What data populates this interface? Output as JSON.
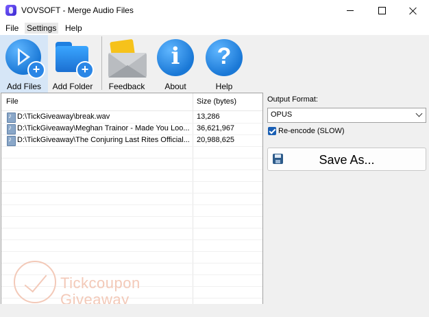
{
  "window": {
    "title": "VOVSOFT - Merge Audio Files"
  },
  "menu": {
    "file": "File",
    "settings": "Settings",
    "help": "Help"
  },
  "toolbar": {
    "add_files": "Add Files",
    "add_folder": "Add Folder",
    "feedback": "Feedback",
    "about": "About",
    "help": "Help"
  },
  "list": {
    "col_file": "File",
    "col_size": "Size (bytes)",
    "rows": [
      {
        "file": "D:\\TickGiveaway\\break.wav",
        "size": "13,286"
      },
      {
        "file": "D:\\TickGiveaway\\Meghan Trainor - Made You Loo...",
        "size": "36,621,967"
      },
      {
        "file": "D:\\TickGiveaway\\The Conjuring Last Rites Official...",
        "size": "20,988,625"
      }
    ]
  },
  "output": {
    "format_label": "Output Format:",
    "format_value": "OPUS",
    "reencode_label": "Re-encode (SLOW)",
    "reencode_checked": true,
    "save_label": "Save As..."
  },
  "watermark": {
    "line1": "Tickcoupon",
    "line2": "Giveaway"
  },
  "colors": {
    "accent": "#1a78d6",
    "selected_tool": "#d6e6f7"
  }
}
